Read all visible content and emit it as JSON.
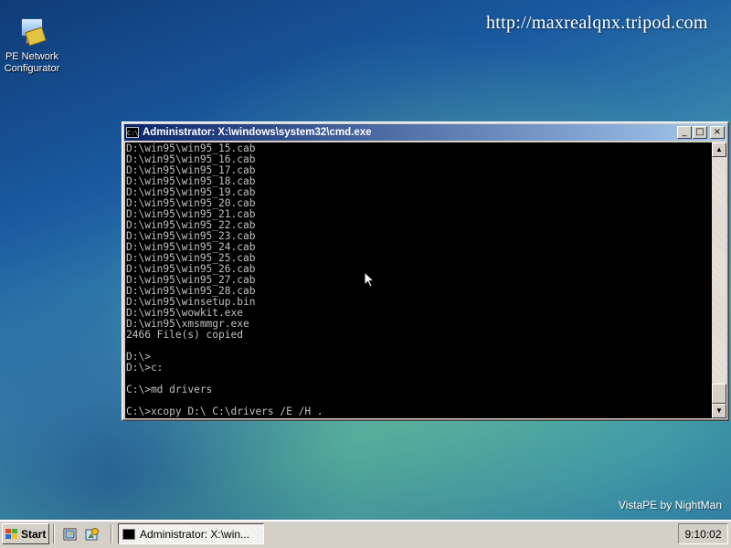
{
  "desktop": {
    "watermark_url": "http://maxrealqnx.tripod.com",
    "watermark_brand": "VistaPE by NightMan",
    "icons": [
      {
        "label_line1": "PE Network",
        "label_line2": "Configurator",
        "icon": "network-config-icon"
      }
    ]
  },
  "window": {
    "title": "Administrator: X:\\windows\\system32\\cmd.exe",
    "buttons": {
      "minimize": "_",
      "maximize": "□",
      "close": "×"
    },
    "console_lines": [
      "D:\\win95\\win95_15.cab",
      "D:\\win95\\win95_16.cab",
      "D:\\win95\\win95_17.cab",
      "D:\\win95\\win95_18.cab",
      "D:\\win95\\win95_19.cab",
      "D:\\win95\\win95_20.cab",
      "D:\\win95\\win95_21.cab",
      "D:\\win95\\win95_22.cab",
      "D:\\win95\\win95_23.cab",
      "D:\\win95\\win95_24.cab",
      "D:\\win95\\win95_25.cab",
      "D:\\win95\\win95_26.cab",
      "D:\\win95\\win95_27.cab",
      "D:\\win95\\win95_28.cab",
      "D:\\win95\\winsetup.bin",
      "D:\\win95\\wowkit.exe",
      "D:\\win95\\xmsmmgr.exe",
      "2466 File(s) copied",
      "",
      "D:\\>",
      "D:\\>c:",
      "",
      "C:\\>md drivers",
      "",
      "C:\\>xcopy D:\\ C:\\drivers /E /H ."
    ]
  },
  "taskbar": {
    "start_label": "Start",
    "task_label": "Administrator: X:\\win...",
    "clock": "9:10:02",
    "quick_launch": [
      "quick-launch-explorer-icon",
      "quick-launch-tool-icon"
    ]
  }
}
